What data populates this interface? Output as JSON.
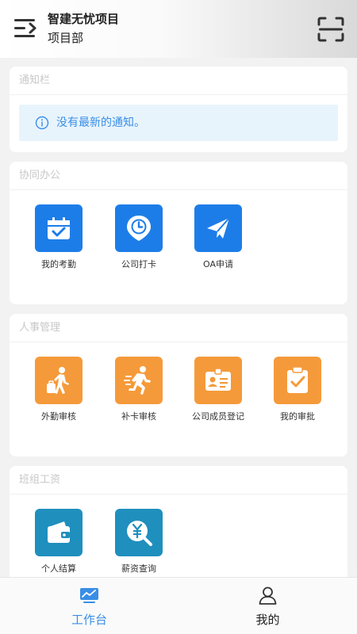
{
  "header": {
    "title": "智建无忧项目",
    "subtitle": "项目部",
    "menu_icon": "menu-icon",
    "scan_icon": "scan-icon"
  },
  "notice_card": {
    "title": "通知栏",
    "message": "没有最新的通知。",
    "icon": "info-icon"
  },
  "collab_card": {
    "title": "协同办公",
    "items": [
      {
        "label": "我的考勤",
        "icon": "calendar-check-icon"
      },
      {
        "label": "公司打卡",
        "icon": "clock-pin-icon"
      },
      {
        "label": "OA申请",
        "icon": "paper-plane-icon"
      }
    ]
  },
  "hr_card": {
    "title": "人事管理",
    "items": [
      {
        "label": "外勤审核",
        "icon": "traveler-icon"
      },
      {
        "label": "补卡审核",
        "icon": "runner-icon"
      },
      {
        "label": "公司成员登记",
        "icon": "id-card-icon"
      },
      {
        "label": "我的审批",
        "icon": "clipboard-check-icon"
      }
    ]
  },
  "wage_card": {
    "title": "班组工资",
    "items": [
      {
        "label": "个人结算",
        "icon": "wallet-icon"
      },
      {
        "label": "薪资查询",
        "icon": "yen-search-icon"
      }
    ]
  },
  "tabbar": {
    "tabs": [
      {
        "label": "工作台",
        "icon": "monitor-chart-icon",
        "active": true
      },
      {
        "label": "我的",
        "icon": "user-icon",
        "active": false
      }
    ]
  },
  "colors": {
    "accent": "#3a8ee6",
    "blue_tile": "#1d7de8",
    "orange_tile": "#f59a3a",
    "teal_tile": "#1f8fbe"
  }
}
